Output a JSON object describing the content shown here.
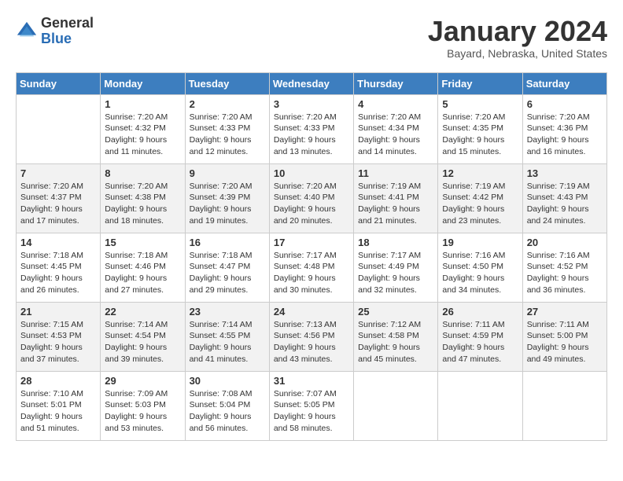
{
  "header": {
    "logo_general": "General",
    "logo_blue": "Blue",
    "month_title": "January 2024",
    "location": "Bayard, Nebraska, United States"
  },
  "days_of_week": [
    "Sunday",
    "Monday",
    "Tuesday",
    "Wednesday",
    "Thursday",
    "Friday",
    "Saturday"
  ],
  "weeks": [
    [
      {
        "day": "",
        "info": ""
      },
      {
        "day": "1",
        "info": "Sunrise: 7:20 AM\nSunset: 4:32 PM\nDaylight: 9 hours\nand 11 minutes."
      },
      {
        "day": "2",
        "info": "Sunrise: 7:20 AM\nSunset: 4:33 PM\nDaylight: 9 hours\nand 12 minutes."
      },
      {
        "day": "3",
        "info": "Sunrise: 7:20 AM\nSunset: 4:33 PM\nDaylight: 9 hours\nand 13 minutes."
      },
      {
        "day": "4",
        "info": "Sunrise: 7:20 AM\nSunset: 4:34 PM\nDaylight: 9 hours\nand 14 minutes."
      },
      {
        "day": "5",
        "info": "Sunrise: 7:20 AM\nSunset: 4:35 PM\nDaylight: 9 hours\nand 15 minutes."
      },
      {
        "day": "6",
        "info": "Sunrise: 7:20 AM\nSunset: 4:36 PM\nDaylight: 9 hours\nand 16 minutes."
      }
    ],
    [
      {
        "day": "7",
        "info": "Sunrise: 7:20 AM\nSunset: 4:37 PM\nDaylight: 9 hours\nand 17 minutes."
      },
      {
        "day": "8",
        "info": "Sunrise: 7:20 AM\nSunset: 4:38 PM\nDaylight: 9 hours\nand 18 minutes."
      },
      {
        "day": "9",
        "info": "Sunrise: 7:20 AM\nSunset: 4:39 PM\nDaylight: 9 hours\nand 19 minutes."
      },
      {
        "day": "10",
        "info": "Sunrise: 7:20 AM\nSunset: 4:40 PM\nDaylight: 9 hours\nand 20 minutes."
      },
      {
        "day": "11",
        "info": "Sunrise: 7:19 AM\nSunset: 4:41 PM\nDaylight: 9 hours\nand 21 minutes."
      },
      {
        "day": "12",
        "info": "Sunrise: 7:19 AM\nSunset: 4:42 PM\nDaylight: 9 hours\nand 23 minutes."
      },
      {
        "day": "13",
        "info": "Sunrise: 7:19 AM\nSunset: 4:43 PM\nDaylight: 9 hours\nand 24 minutes."
      }
    ],
    [
      {
        "day": "14",
        "info": "Sunrise: 7:18 AM\nSunset: 4:45 PM\nDaylight: 9 hours\nand 26 minutes."
      },
      {
        "day": "15",
        "info": "Sunrise: 7:18 AM\nSunset: 4:46 PM\nDaylight: 9 hours\nand 27 minutes."
      },
      {
        "day": "16",
        "info": "Sunrise: 7:18 AM\nSunset: 4:47 PM\nDaylight: 9 hours\nand 29 minutes."
      },
      {
        "day": "17",
        "info": "Sunrise: 7:17 AM\nSunset: 4:48 PM\nDaylight: 9 hours\nand 30 minutes."
      },
      {
        "day": "18",
        "info": "Sunrise: 7:17 AM\nSunset: 4:49 PM\nDaylight: 9 hours\nand 32 minutes."
      },
      {
        "day": "19",
        "info": "Sunrise: 7:16 AM\nSunset: 4:50 PM\nDaylight: 9 hours\nand 34 minutes."
      },
      {
        "day": "20",
        "info": "Sunrise: 7:16 AM\nSunset: 4:52 PM\nDaylight: 9 hours\nand 36 minutes."
      }
    ],
    [
      {
        "day": "21",
        "info": "Sunrise: 7:15 AM\nSunset: 4:53 PM\nDaylight: 9 hours\nand 37 minutes."
      },
      {
        "day": "22",
        "info": "Sunrise: 7:14 AM\nSunset: 4:54 PM\nDaylight: 9 hours\nand 39 minutes."
      },
      {
        "day": "23",
        "info": "Sunrise: 7:14 AM\nSunset: 4:55 PM\nDaylight: 9 hours\nand 41 minutes."
      },
      {
        "day": "24",
        "info": "Sunrise: 7:13 AM\nSunset: 4:56 PM\nDaylight: 9 hours\nand 43 minutes."
      },
      {
        "day": "25",
        "info": "Sunrise: 7:12 AM\nSunset: 4:58 PM\nDaylight: 9 hours\nand 45 minutes."
      },
      {
        "day": "26",
        "info": "Sunrise: 7:11 AM\nSunset: 4:59 PM\nDaylight: 9 hours\nand 47 minutes."
      },
      {
        "day": "27",
        "info": "Sunrise: 7:11 AM\nSunset: 5:00 PM\nDaylight: 9 hours\nand 49 minutes."
      }
    ],
    [
      {
        "day": "28",
        "info": "Sunrise: 7:10 AM\nSunset: 5:01 PM\nDaylight: 9 hours\nand 51 minutes."
      },
      {
        "day": "29",
        "info": "Sunrise: 7:09 AM\nSunset: 5:03 PM\nDaylight: 9 hours\nand 53 minutes."
      },
      {
        "day": "30",
        "info": "Sunrise: 7:08 AM\nSunset: 5:04 PM\nDaylight: 9 hours\nand 56 minutes."
      },
      {
        "day": "31",
        "info": "Sunrise: 7:07 AM\nSunset: 5:05 PM\nDaylight: 9 hours\nand 58 minutes."
      },
      {
        "day": "",
        "info": ""
      },
      {
        "day": "",
        "info": ""
      },
      {
        "day": "",
        "info": ""
      }
    ]
  ]
}
